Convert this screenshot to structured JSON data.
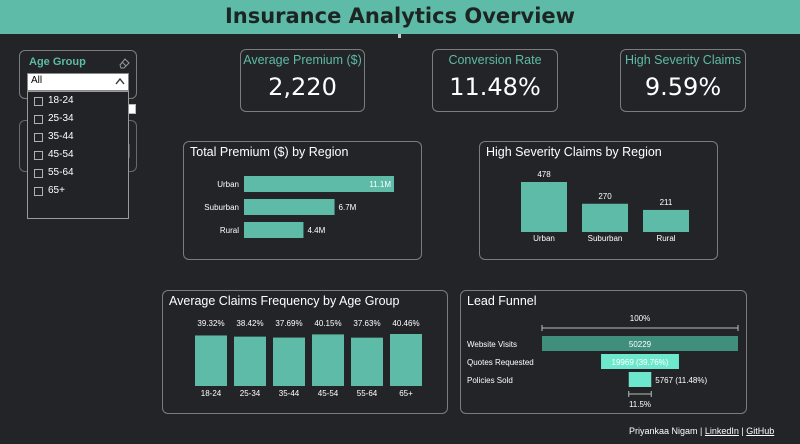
{
  "header": {
    "title": "Insurance Analytics Overview"
  },
  "slicer": {
    "title": "Age Group",
    "selected": "All",
    "options": [
      "18-24",
      "25-34",
      "35-44",
      "45-54",
      "55-64",
      "65+"
    ]
  },
  "kpis": [
    {
      "label": "Average Premium ($)",
      "value": "2,220"
    },
    {
      "label": "Conversion Rate",
      "value": "11.48%"
    },
    {
      "label": "High Severity Claims",
      "value": "9.59%"
    }
  ],
  "chart_data": [
    {
      "type": "bar",
      "orientation": "horizontal",
      "title": "Total Premium ($) by Region",
      "categories": [
        "Urban",
        "Suburban",
        "Rural"
      ],
      "values": [
        11.1,
        6.7,
        4.4
      ],
      "data_labels": [
        "11.1M",
        "6.7M",
        "4.4M"
      ]
    },
    {
      "type": "bar",
      "title": "High Severity Claims by Region",
      "categories": [
        "Urban",
        "Suburban",
        "Rural"
      ],
      "values": [
        478,
        270,
        211
      ],
      "data_labels": [
        "478",
        "270",
        "211"
      ]
    },
    {
      "type": "bar",
      "title": "Average Claims Frequency by Age Group",
      "categories": [
        "18-24",
        "25-34",
        "35-44",
        "45-54",
        "55-64",
        "65+"
      ],
      "values": [
        39.32,
        38.42,
        37.69,
        40.15,
        37.63,
        40.46
      ],
      "data_labels": [
        "39.32%",
        "38.42%",
        "37.69%",
        "40.15%",
        "37.63%",
        "40.46%"
      ]
    },
    {
      "type": "bar",
      "subtype": "funnel",
      "title": "Lead Funnel",
      "categories": [
        "Website Visits",
        "Quotes Requested",
        "Policies Sold"
      ],
      "values": [
        50229,
        19969,
        5767
      ],
      "data_labels": [
        "50229",
        "19969 (39.76%)",
        "5767 (11.48%)"
      ],
      "top_label": "100%",
      "bottom_label": "11.5%"
    }
  ],
  "colors": {
    "accent": "#5dbba7",
    "funnel_top": "#3f8f7c",
    "funnel_highlight": "#6ee8cc",
    "background": "#232428"
  },
  "footer": {
    "author": "Priyankaa Nigam",
    "linkedin": "LinkedIn",
    "github": "GitHub",
    "separator": " | "
  }
}
